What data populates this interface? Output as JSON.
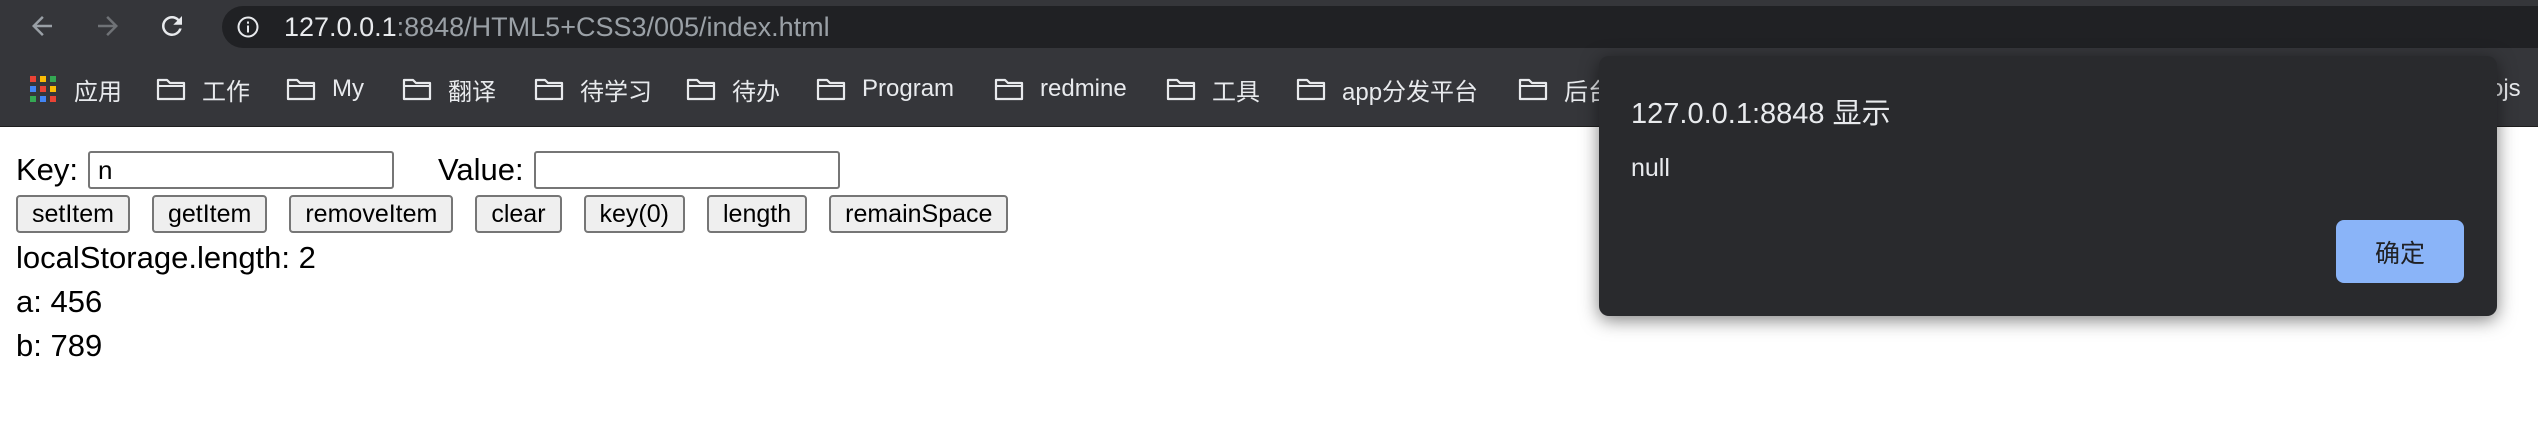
{
  "browser": {
    "url_host": "127.0.0.1",
    "url_rest": ":8848/HTML5+CSS3/005/index.html"
  },
  "bookmarks": [
    {
      "label": "应用",
      "icon": "apps-grid-icon"
    },
    {
      "label": "工作",
      "icon": "folder-icon"
    },
    {
      "label": "My",
      "icon": "folder-icon"
    },
    {
      "label": "翻译",
      "icon": "folder-icon"
    },
    {
      "label": "待学习",
      "icon": "folder-icon"
    },
    {
      "label": "待办",
      "icon": "folder-icon"
    },
    {
      "label": "Program",
      "icon": "folder-icon"
    },
    {
      "label": "redmine",
      "icon": "folder-icon"
    },
    {
      "label": "工具",
      "icon": "folder-icon"
    },
    {
      "label": "app分发平台",
      "icon": "folder-icon"
    },
    {
      "label": "后台",
      "icon": "folder-icon"
    }
  ],
  "bookmark_overflow": "ojs",
  "form": {
    "key_label": "Key:",
    "key_value": "n",
    "value_label": "Value:",
    "value_value": ""
  },
  "buttons": {
    "set": "setItem",
    "get": "getItem",
    "remove": "removeItem",
    "clear": "clear",
    "key0": "key(0)",
    "length": "length",
    "remain": "remainSpace"
  },
  "output": {
    "length_line": "localStorage.length: 2",
    "entries": [
      "a: 456",
      "b: 789"
    ]
  },
  "alert": {
    "title": "127.0.0.1:8848 显示",
    "message": "null",
    "ok_label": "确定"
  },
  "colors": {
    "chrome_bg": "#35363a",
    "omnibox_bg": "#202124",
    "dialog_bg": "#292a2d",
    "dialog_button": "#8ab4f8"
  }
}
